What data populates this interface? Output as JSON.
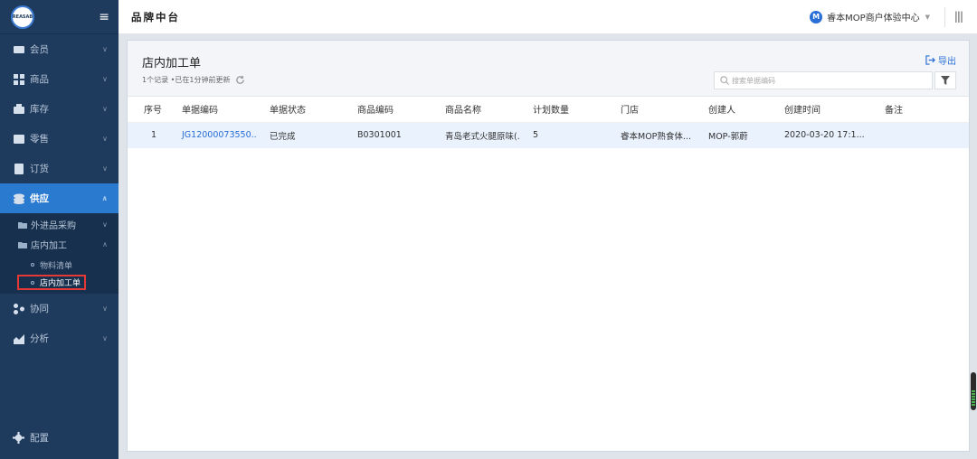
{
  "logo": {
    "text": "REASAB"
  },
  "header": {
    "title": "品牌中台",
    "tenant_badge": "M",
    "tenant_name": "睿本MOP商户体验中心"
  },
  "sidebar": {
    "items": [
      {
        "label": "会员",
        "icon": "member-icon"
      },
      {
        "label": "商品",
        "icon": "goods-icon"
      },
      {
        "label": "库存",
        "icon": "inventory-icon"
      },
      {
        "label": "零售",
        "icon": "retail-icon"
      },
      {
        "label": "订货",
        "icon": "order-icon"
      },
      {
        "label": "供应",
        "icon": "supply-icon"
      }
    ],
    "supply_children": [
      {
        "label": "外进品采购"
      },
      {
        "label": "店内加工"
      }
    ],
    "leaves": [
      {
        "label": "物料清单"
      },
      {
        "label": "店内加工单"
      }
    ],
    "items_after": [
      {
        "label": "协同",
        "icon": "collab-icon"
      },
      {
        "label": "分析",
        "icon": "analysis-icon"
      }
    ],
    "config": {
      "label": "配置",
      "icon": "gear-icon"
    }
  },
  "page": {
    "title": "店内加工单",
    "subtitle": "1个记录 •已在1分钟前更新",
    "export_label": "导出",
    "search_placeholder": "搜索单据编码"
  },
  "table": {
    "columns": [
      "序号",
      "单据编码",
      "单据状态",
      "商品编码",
      "商品名称",
      "计划数量",
      "门店",
      "创建人",
      "创建时间",
      "备注"
    ],
    "rows": [
      [
        "1",
        "JG12000073550...",
        "已完成",
        "B0301001",
        "青岛老式火腿原味(...",
        "5",
        "睿本MOP熟食体...",
        "MOP-郭蔚",
        "2020-03-20 17:1...",
        ""
      ]
    ]
  }
}
